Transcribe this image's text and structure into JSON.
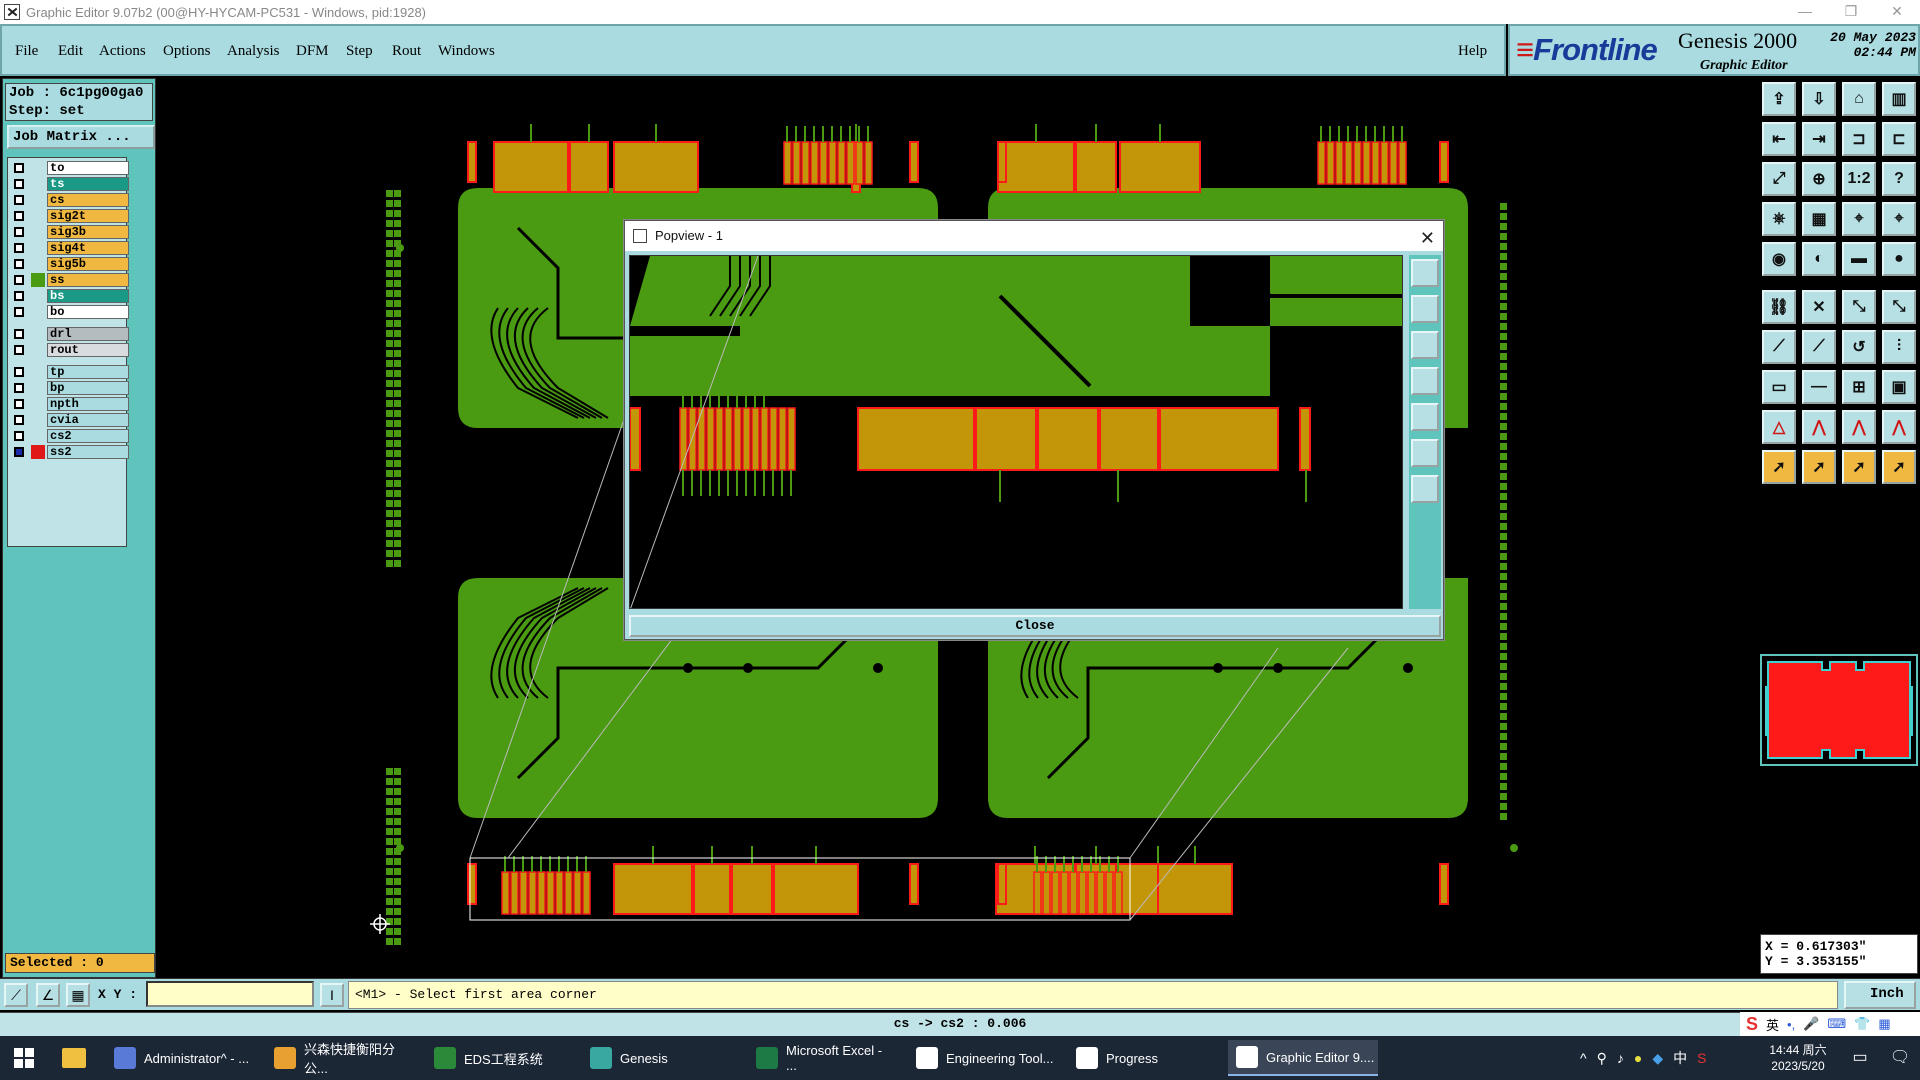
{
  "window": {
    "title": "Graphic Editor 9.07b2 (00@HY-HYCAM-PC531 - Windows, pid:1928)"
  },
  "menu": [
    "File",
    "Edit",
    "Actions",
    "Options",
    "Analysis",
    "DFM",
    "Step",
    "Rout",
    "Windows"
  ],
  "help_label": "Help",
  "brand": {
    "logo_prefix": "≡",
    "logo": "Frontline",
    "product": "Genesis 2000",
    "subtitle": "Graphic Editor",
    "date": "20 May 2023",
    "time": "02:44 PM"
  },
  "job": {
    "job_line": "Job : 6c1pg00ga0",
    "step_line": "Step: set",
    "matrix_button": "Job Matrix ..."
  },
  "layers": [
    {
      "name": "to",
      "color": "#ffffff"
    },
    {
      "name": "ts",
      "color": "#1a9a86"
    },
    {
      "name": "cs",
      "color": "#f0b840"
    },
    {
      "name": "sig2t",
      "color": "#f0b840"
    },
    {
      "name": "sig3b",
      "color": "#f0b840"
    },
    {
      "name": "sig4t",
      "color": "#f0b840"
    },
    {
      "name": "sig5b",
      "color": "#f0b840"
    },
    {
      "name": "ss",
      "color": "#f0b840"
    },
    {
      "name": "bs",
      "color": "#1a9a86"
    },
    {
      "name": "bo",
      "color": "#ffffff"
    },
    {
      "name": "drl",
      "color": "#b4bcc0"
    },
    {
      "name": "rout",
      "color": "#d8dcde"
    },
    {
      "name": "tp",
      "color": "#a9dbe0"
    },
    {
      "name": "bp",
      "color": "#a9dbe0"
    },
    {
      "name": "npth",
      "color": "#a9dbe0"
    },
    {
      "name": "cvia",
      "color": "#a9dbe0"
    },
    {
      "name": "cs2",
      "color": "#a9dbe0"
    },
    {
      "name": "ss2",
      "color": "#a9dbe0"
    }
  ],
  "selected_text": "Selected : 0",
  "popview": {
    "title": "Popview - 1",
    "close_label": "Close"
  },
  "coords": {
    "x": "X = 0.617303\"",
    "y": "Y = 3.353155\""
  },
  "cmd": {
    "xy_label": "X Y :",
    "xy_value": "",
    "prompt": "<M1> - Select first area corner",
    "units": "Inch"
  },
  "status_text": "cs -> cs2 : 0.006",
  "taskbar": [
    {
      "label": "Administrator^ - ...",
      "color": "#5a7ad8"
    },
    {
      "label": "兴森快捷衡阳分公...",
      "color": "#e8a030"
    },
    {
      "label": "EDS工程系统",
      "color": "#2a8a3a"
    },
    {
      "label": "Genesis",
      "color": "#38a8a0"
    },
    {
      "label": "Microsoft Excel - ...",
      "color": "#1e7a44"
    },
    {
      "label": "Engineering Tool...",
      "color": "#ffffff"
    },
    {
      "label": "Progress",
      "color": "#ffffff"
    },
    {
      "label": "Graphic Editor 9....",
      "color": "#ffffff"
    }
  ],
  "tray": {
    "ime": "英",
    "lang": "中",
    "time": "14:44 周六",
    "date": "2023/5/20"
  },
  "colors": {
    "board": "#4a9a12",
    "copper": "#c29608",
    "pad_outline": "#ff1a1a",
    "panel": "#a9dbe0",
    "teal": "#5fc4bc"
  }
}
